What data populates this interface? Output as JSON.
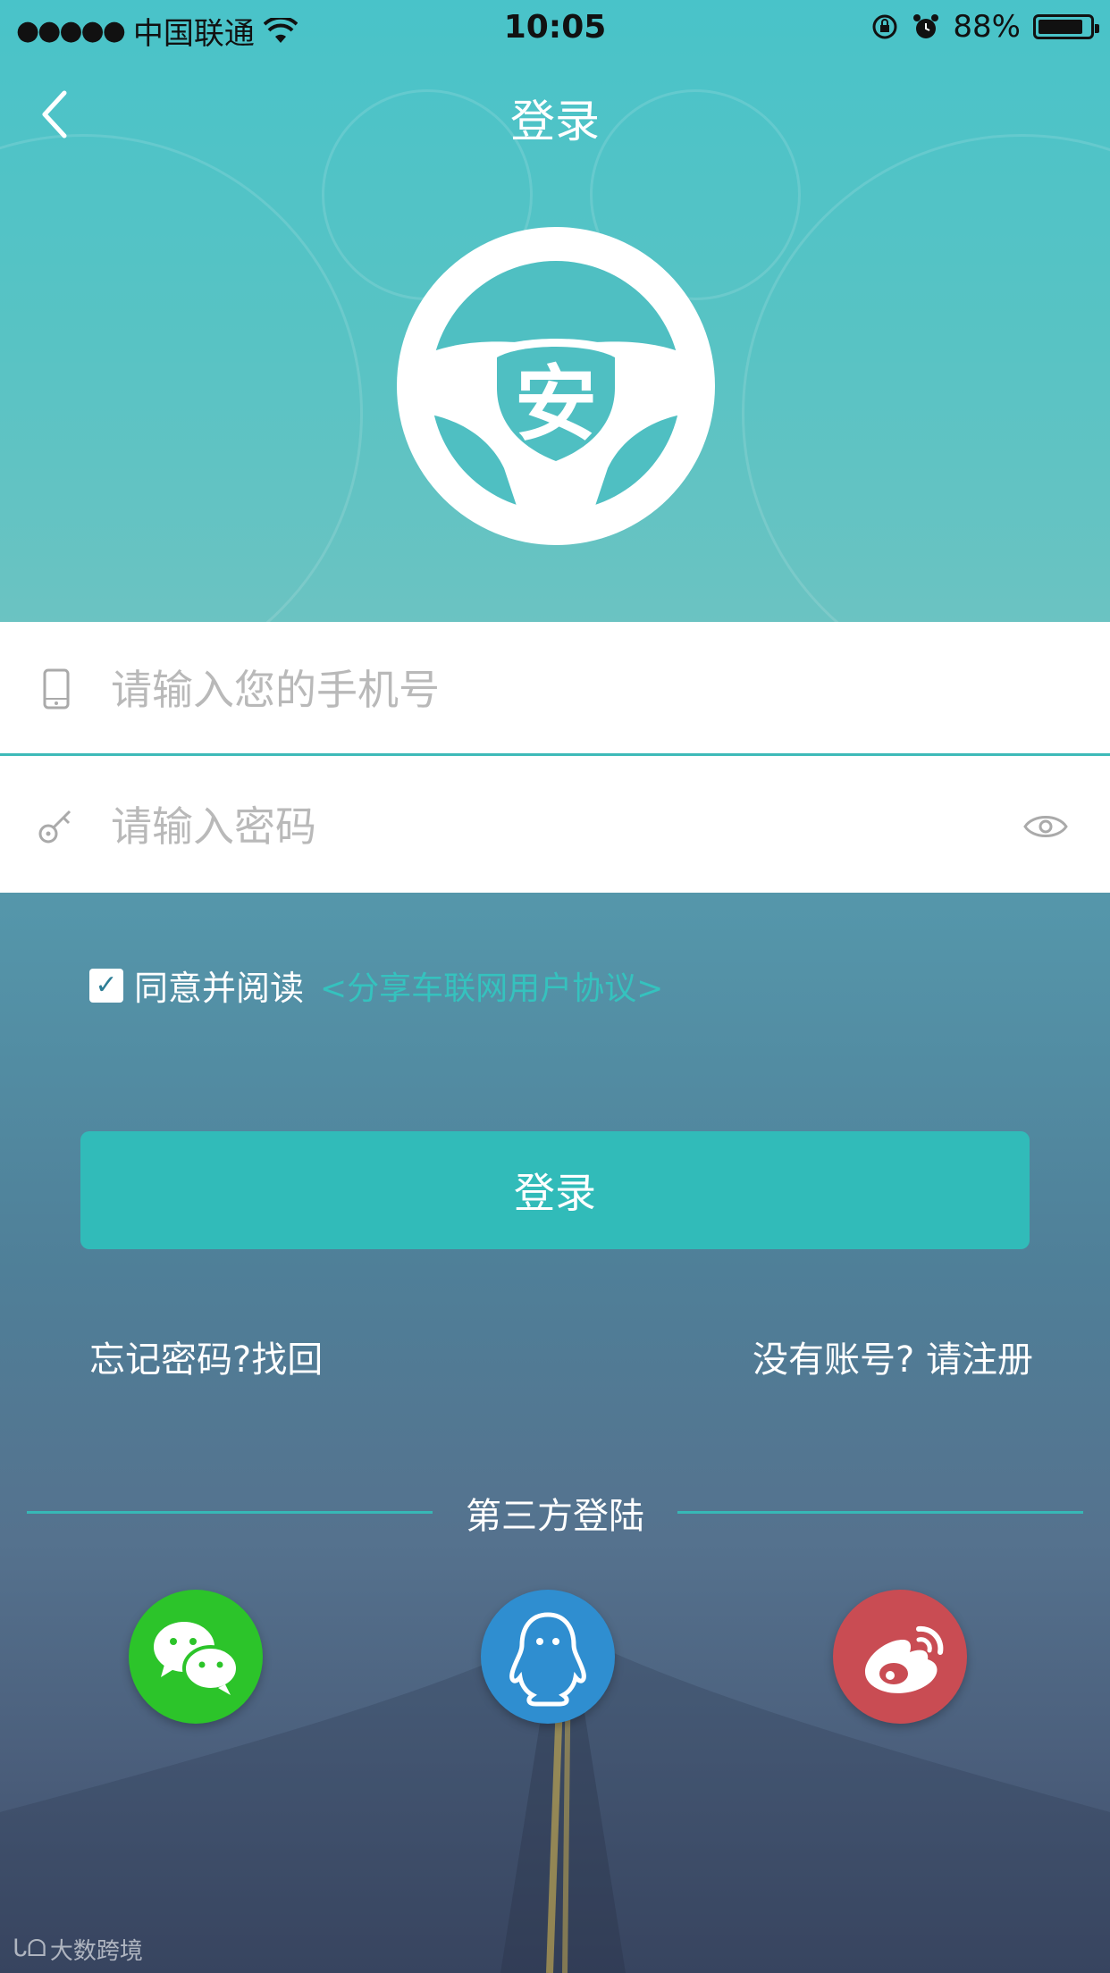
{
  "status_bar": {
    "signal": "●●●●●",
    "carrier": "中国联通",
    "time": "10:05",
    "battery_percent": "88%",
    "battery_level": 0.88
  },
  "nav": {
    "title": "登录"
  },
  "logo": {
    "char": "安"
  },
  "form": {
    "phone_placeholder": "请输入您的手机号",
    "phone_value": "",
    "password_placeholder": "请输入密码",
    "password_value": ""
  },
  "agreement": {
    "checked": true,
    "text": "同意并阅读",
    "link": "<分享车联网用户协议>"
  },
  "login_button": "登录",
  "links": {
    "forgot": "忘记密码?找回",
    "register": "没有账号? 请注册"
  },
  "third_party": {
    "title": "第三方登陆",
    "providers": [
      "wechat-icon",
      "qq-icon",
      "weibo-icon"
    ]
  },
  "watermark": "大数跨境",
  "colors": {
    "accent": "#31bbb9",
    "header_bg": "#58c3c4",
    "wechat": "#2cc42a",
    "qq": "#2f8ed0",
    "weibo": "#c94c53"
  }
}
